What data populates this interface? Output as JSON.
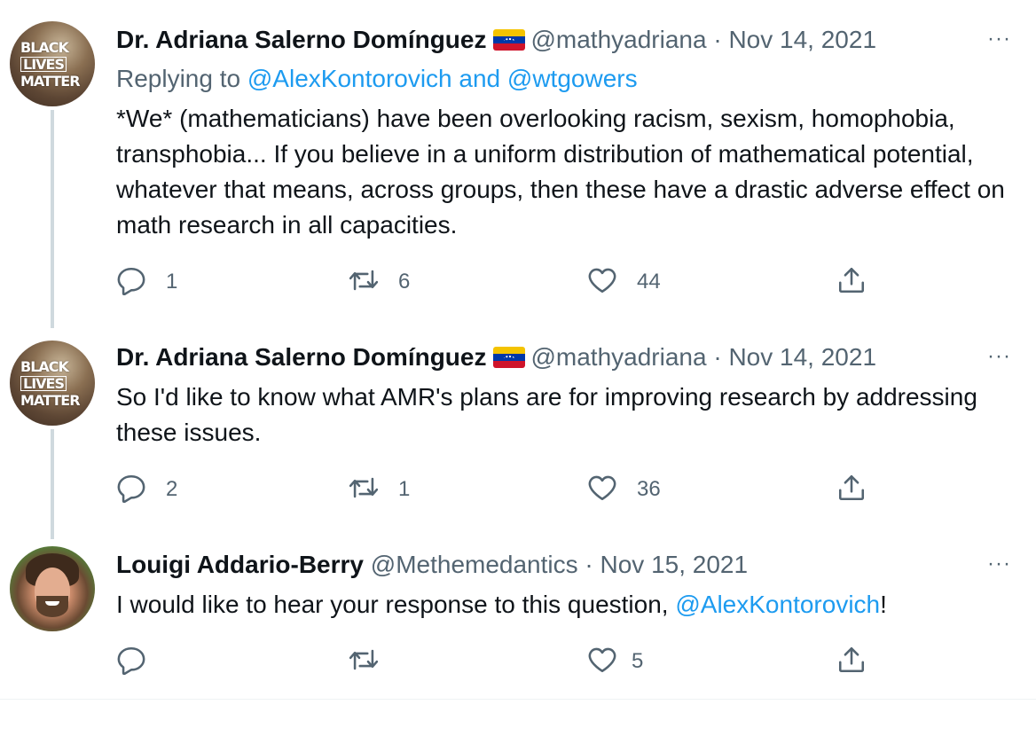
{
  "tweets": [
    {
      "name": "Dr. Adriana Salerno Domínguez",
      "handle": "@mathyadriana",
      "separator": "·",
      "date": "Nov 14, 2021",
      "more": "···",
      "avatar_text": [
        "BLACK",
        "LIVES",
        "MATTER"
      ],
      "replying_prefix": "Replying to ",
      "replying_links": "@AlexKontorovich and @wtgowers",
      "text": "*We* (mathematicians) have been overlooking racism, sexism, homophobia, transphobia... If you believe in a uniform distribution of mathematical potential, whatever that means, across groups, then these have a drastic adverse effect on math research in all capacities.",
      "counts": {
        "replies": "1",
        "retweets": "6",
        "likes": "44"
      }
    },
    {
      "name": "Dr. Adriana Salerno Domínguez",
      "handle": "@mathyadriana",
      "separator": "·",
      "date": "Nov 14, 2021",
      "more": "···",
      "avatar_text": [
        "BLACK",
        "LIVES",
        "MATTER"
      ],
      "text": "So I'd like to know what AMR's plans are for improving research by addressing these issues.",
      "counts": {
        "replies": "2",
        "retweets": "1",
        "likes": "36"
      }
    },
    {
      "name": "Louigi Addario-Berry",
      "handle": "@Methemedantics",
      "separator": "·",
      "date": "Nov 15, 2021",
      "more": "···",
      "text_before": "I would like to hear your response to this question, ",
      "text_link": "@AlexKontorovich",
      "text_after": "!",
      "counts": {
        "replies": "",
        "retweets": "",
        "likes": "5"
      }
    }
  ],
  "colors": {
    "text": "#0f1419",
    "muted": "#536471",
    "link": "#1d9bf0",
    "thread_line": "#cfd9de"
  },
  "icons": [
    "reply-icon",
    "retweet-icon",
    "like-icon",
    "share-icon",
    "more-icon"
  ]
}
